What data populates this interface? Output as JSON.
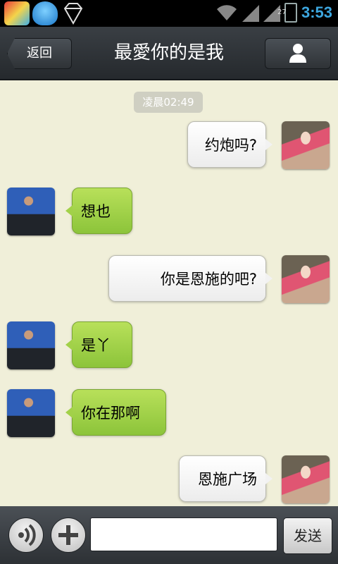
{
  "status_bar": {
    "time": "3:53",
    "battery_level": "27",
    "icons": [
      "app-icon-browser",
      "qq-penguin-icon",
      "diamond-icon",
      "wifi-icon",
      "signal-icon",
      "signal-icon",
      "battery-icon"
    ]
  },
  "header": {
    "back_label": "返回",
    "title": "最愛你的是我",
    "profile_icon": "person-icon"
  },
  "chat": {
    "timestamp": "凌晨02:49",
    "messages": [
      {
        "direction": "out",
        "text": "约炮吗?"
      },
      {
        "direction": "in",
        "text": "想也"
      },
      {
        "direction": "out",
        "text": "你是恩施的吧?"
      },
      {
        "direction": "in",
        "text": "是丫"
      },
      {
        "direction": "in",
        "text": "你在那啊"
      },
      {
        "direction": "out",
        "text": "恩施广场"
      }
    ]
  },
  "input": {
    "value": "",
    "send_label": "发送",
    "voice_icon": "voice-icon",
    "plus_icon": "plus-icon"
  },
  "colors": {
    "chat_background": "#f0efd9",
    "incoming_bubble": "#a2d149",
    "outgoing_bubble": "#f2f2f2",
    "status_time": "#3da7e0"
  }
}
